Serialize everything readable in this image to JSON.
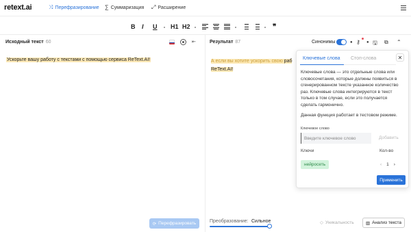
{
  "app": {
    "logo_main": "retext",
    "logo_ai": ".ai"
  },
  "nav": {
    "paraphrase": {
      "label": "Перефразирование",
      "icon": "shuffle-icon"
    },
    "summarize": {
      "label": "Суммаризация",
      "icon": "sigma-icon"
    },
    "expand": {
      "label": "Расширение",
      "icon": "expand-icon"
    }
  },
  "toolbar": {
    "bold": "B",
    "italic": "I",
    "underline": "U",
    "h1": "H1",
    "h2": "H2",
    "quote": "❞"
  },
  "source": {
    "title": "Исходный текст",
    "count": "60",
    "text": "Ускорьте вашу работу с текстами с помощью сервиса ReText.AI!",
    "paraphrase_button": "Перефразировать"
  },
  "result": {
    "title": "Результат",
    "count": "87",
    "synonyms_label": "Синонимы",
    "text_faint": "А если вы хотите ускорить свою ",
    "text_main": "раб",
    "text_line2": "ReText.AI!"
  },
  "keywords_popup": {
    "tab_keywords": "Ключевые слова",
    "tab_stopwords": "Стоп-слова",
    "description": "Ключевые слова — это отдельные слова или словосочетания, которые должны появиться в сгенерированном тексте указанное количество раз. Ключевые слова интегрируются в текст только в том случае, если это получается сделать гармонично.",
    "note": "Данная функция работает в тестовом режиме.",
    "input_label": "Ключевое слово",
    "input_placeholder": "Введите ключевое слово",
    "add_button": "Добавить",
    "col_keys": "Ключи",
    "col_count": "Кол-во",
    "keyword": "нейросеть",
    "keyword_count": "1",
    "apply_button": "Применить"
  },
  "bottom": {
    "mode_label": "Преобразование:",
    "mode_value": "Сильное",
    "mode_level": 1.0,
    "uniqueness_button": "Уникальность",
    "analysis_button": "Анализ текста"
  },
  "colors": {
    "accent": "#2a73d9",
    "highlight": "#fde9b6",
    "chip": "#d2f3dc"
  }
}
